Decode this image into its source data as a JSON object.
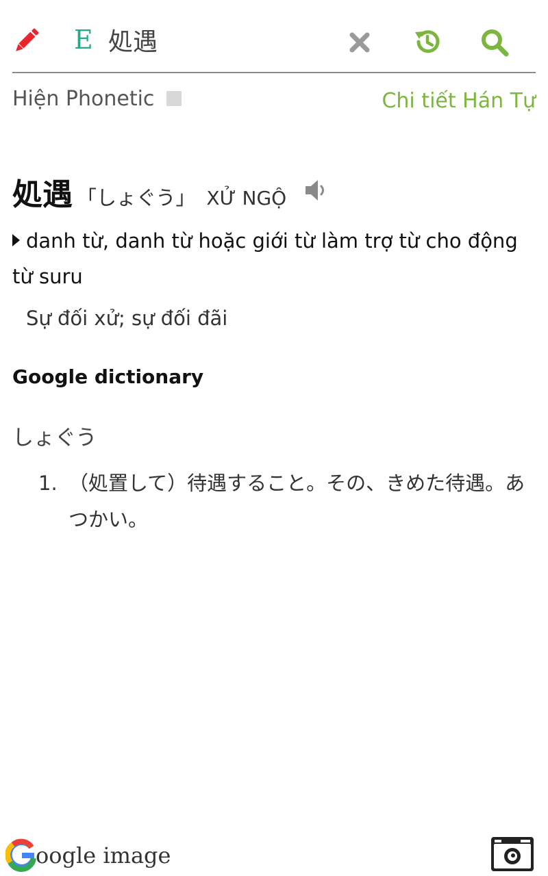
{
  "search": {
    "lang": "E",
    "query": "処遇"
  },
  "options": {
    "phonetic_label": "Hiện Phonetic",
    "kanji_detail_link": "Chi tiết Hán Tự"
  },
  "entry": {
    "word": "処遇",
    "reading": "「しょぐう」",
    "hanviet": "XỬ NGỘ",
    "part_of_speech": "danh từ, danh từ hoặc giới từ làm trợ từ cho động từ suru",
    "meaning": "Sự đối xử; sự đối đãi"
  },
  "google_dictionary": {
    "header": "Google dictionary",
    "reading": "しょぐう",
    "definitions": [
      {
        "num": "1.",
        "text": "（処置して）待遇すること。その、きめた待遇。あつかい。"
      }
    ]
  },
  "footer": {
    "google_image_label": "oogle image"
  },
  "colors": {
    "pencil": "#e8262c",
    "lang": "#29a88a",
    "accent_green": "#7cb540",
    "clear_gray": "#9a9a9a"
  },
  "icons": [
    "pencil-icon",
    "clear-icon",
    "history-icon",
    "search-icon",
    "speaker-icon",
    "google-g-icon",
    "camera-icon"
  ]
}
